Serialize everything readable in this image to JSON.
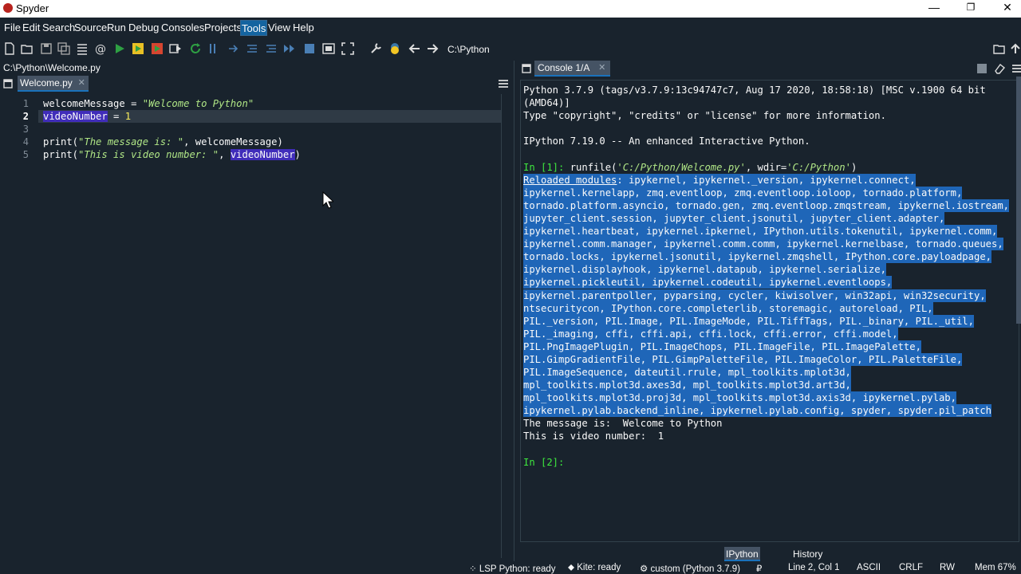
{
  "window": {
    "title": "Spyder"
  },
  "menu": [
    "File",
    "Edit",
    "Search",
    "Source",
    "Run",
    "Debug",
    "Consoles",
    "Projects",
    "Tools",
    "View",
    "Help"
  ],
  "menu_active": "Tools",
  "toolbar": {
    "path": "C:\\Python"
  },
  "editor": {
    "file_path": "C:\\Python\\Welcome.py",
    "tab_label": "Welcome.py",
    "close_glyph": "✕",
    "line_numbers": [
      "1",
      "2",
      "3",
      "4",
      "5"
    ],
    "lines": {
      "l1_var": "welcomeMessage",
      "l1_op": " = ",
      "l1_str": "\"Welcome to Python\"",
      "l2_var": "videoNumber",
      "l2_op": " = ",
      "l2_num": "1",
      "l4_a": "print(",
      "l4_str": "\"The message is: \"",
      "l4_b": ", welcomeMessage)",
      "l5_a": "print(",
      "l5_str": "\"This is video number: \"",
      "l5_b": ", ",
      "l5_var": "videoNumber",
      "l5_c": ")"
    }
  },
  "console": {
    "tab_label": "Console 1/A",
    "lines": [
      "Python 3.7.9 (tags/v3.7.9:13c94747c7, Aug 17 2020, 18:58:18) [MSC v.1900 64 bit",
      "(AMD64)]",
      "Type \"copyright\", \"credits\" or \"license\" for more information.",
      "",
      "IPython 7.19.0 -- An enhanced Interactive Python.",
      ""
    ],
    "in1_prompt": "In [1]: ",
    "in1_cmd_a": "runfile(",
    "in1_str1": "'C:/Python/Welcome.py'",
    "in1_cmd_b": ", wdir=",
    "in1_str2": "'C:/Python'",
    "in1_cmd_c": ")",
    "reloaded_label": "Reloaded modules",
    "reloaded_lines": [
      ": ipykernel, ipykernel._version, ipykernel.connect,",
      "ipykernel.kernelapp, zmq.eventloop, zmq.eventloop.ioloop, tornado.platform,",
      "tornado.platform.asyncio, tornado.gen, zmq.eventloop.zmqstream, ipykernel.iostream,",
      "jupyter_client.session, jupyter_client.jsonutil, jupyter_client.adapter,",
      "ipykernel.heartbeat, ipykernel.ipkernel, IPython.utils.tokenutil, ipykernel.comm,",
      "ipykernel.comm.manager, ipykernel.comm.comm, ipykernel.kernelbase, tornado.queues,",
      "tornado.locks, ipykernel.jsonutil, ipykernel.zmqshell, IPython.core.payloadpage,",
      "ipykernel.displayhook, ipykernel.datapub, ipykernel.serialize,",
      "ipykernel.pickleutil, ipykernel.codeutil, ipykernel.eventloops,",
      "ipykernel.parentpoller, pyparsing, cycler, kiwisolver, win32api, win32security,",
      "ntsecuritycon, IPython.core.completerlib, storemagic, autoreload, PIL,",
      "PIL._version, PIL.Image, PIL.ImageMode, PIL.TiffTags, PIL._binary, PIL._util,",
      "PIL._imaging, cffi, cffi.api, cffi.lock, cffi.error, cffi.model,",
      "PIL.PngImagePlugin, PIL.ImageChops, PIL.ImageFile, PIL.ImagePalette,",
      "PIL.GimpGradientFile, PIL.GimpPaletteFile, PIL.ImageColor, PIL.PaletteFile,",
      "PIL.ImageSequence, dateutil.rrule, mpl_toolkits.mplot3d,",
      "mpl_toolkits.mplot3d.axes3d, mpl_toolkits.mplot3d.art3d,",
      "mpl_toolkits.mplot3d.proj3d, mpl_toolkits.mplot3d.axis3d, ipykernel.pylab,",
      "ipykernel.pylab.backend_inline, ipykernel.pylab.config, spyder, spyder.pil_patch"
    ],
    "out_lines": [
      "The message is:  Welcome to Python",
      "This is video number:  1"
    ],
    "in2_prompt": "In [2]:"
  },
  "bottom_tabs": [
    "IPython console",
    "History"
  ],
  "status": {
    "lsp": "LSP Python: ready",
    "kite": "Kite: ready",
    "env": "custom (Python 3.7.9)",
    "git": "₽",
    "position": "Line 2, Col 1",
    "encoding": "ASCII",
    "eol": "CRLF",
    "rw": "RW",
    "mem": "Mem 67%"
  },
  "colors": {
    "background": "#19232d",
    "selection": "#1f66b8",
    "accent": "#1464a0"
  }
}
